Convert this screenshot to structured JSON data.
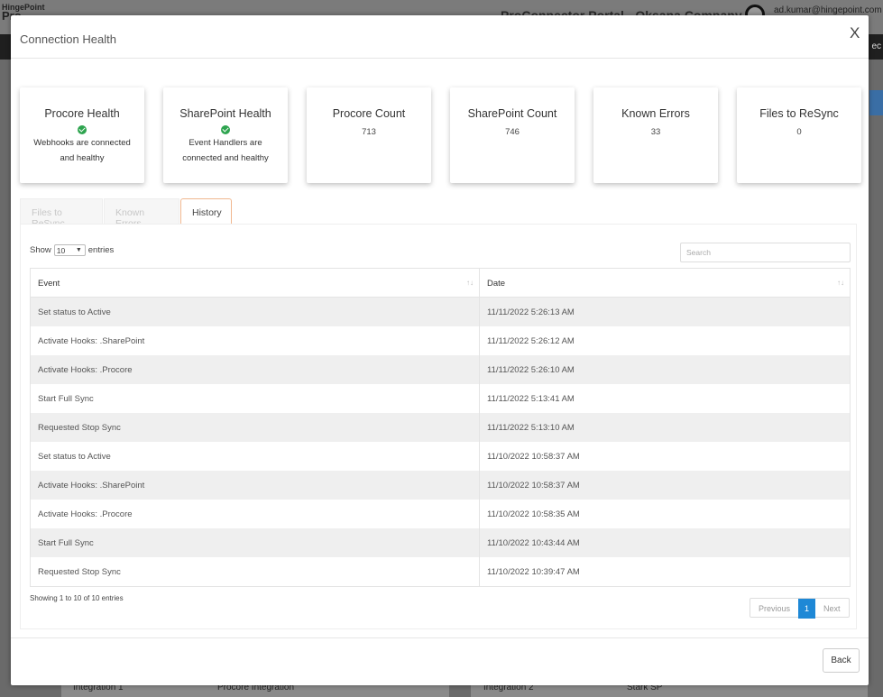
{
  "background": {
    "logo_small": "HingePoint",
    "logo_big": "Pro",
    "portal_title": "ProConnector Portal - Oksana Company",
    "user_email": "ad.kumar@hingepoint.com",
    "dark_bar_text": "ec",
    "bottom_rows": [
      {
        "label": "Integration 1",
        "value": "Procore Integration"
      },
      {
        "label": "Integration 2",
        "value": "Stark SP"
      }
    ]
  },
  "modal": {
    "title": "Connection Health",
    "close_label": "X",
    "back_label": "Back"
  },
  "cards": [
    {
      "title": "Procore Health",
      "check": true,
      "text": "Webhooks are connected and healthy"
    },
    {
      "title": "SharePoint Health",
      "check": true,
      "text": "Event Handlers are connected and healthy"
    },
    {
      "title": "Procore Count",
      "value": "713"
    },
    {
      "title": "SharePoint Count",
      "value": "746"
    },
    {
      "title": "Known Errors",
      "value": "33"
    },
    {
      "title": "Files to ReSync",
      "value": "0"
    }
  ],
  "tabs": [
    {
      "label": "Files to ReSync",
      "active": false
    },
    {
      "label": "Known Errors",
      "active": false
    },
    {
      "label": "History",
      "active": true
    }
  ],
  "table_controls": {
    "show_label": "Show",
    "entries_label": "entries",
    "page_size": "10",
    "search_placeholder": "Search"
  },
  "table": {
    "columns": [
      "Event",
      "Date"
    ],
    "rows": [
      [
        "Set status to Active",
        "11/11/2022 5:26:13 AM"
      ],
      [
        "Activate Hooks: .SharePoint",
        "11/11/2022 5:26:12 AM"
      ],
      [
        "Activate Hooks: .Procore",
        "11/11/2022 5:26:10 AM"
      ],
      [
        "Start Full Sync",
        "11/11/2022 5:13:41 AM"
      ],
      [
        "Requested Stop Sync",
        "11/11/2022 5:13:10 AM"
      ],
      [
        "Set status to Active",
        "11/10/2022 10:58:37 AM"
      ],
      [
        "Activate Hooks: .SharePoint",
        "11/10/2022 10:58:37 AM"
      ],
      [
        "Activate Hooks: .Procore",
        "11/10/2022 10:58:35 AM"
      ],
      [
        "Start Full Sync",
        "11/10/2022 10:43:44 AM"
      ],
      [
        "Requested Stop Sync",
        "11/10/2022 10:39:47 AM"
      ]
    ]
  },
  "pagination": {
    "info": "Showing 1 to 10 of 10 entries",
    "previous": "Previous",
    "current": "1",
    "next": "Next"
  },
  "colors": {
    "accent": "#1e88d6",
    "success": "#2ea44f",
    "active_tab_border": "#f0b78f"
  }
}
